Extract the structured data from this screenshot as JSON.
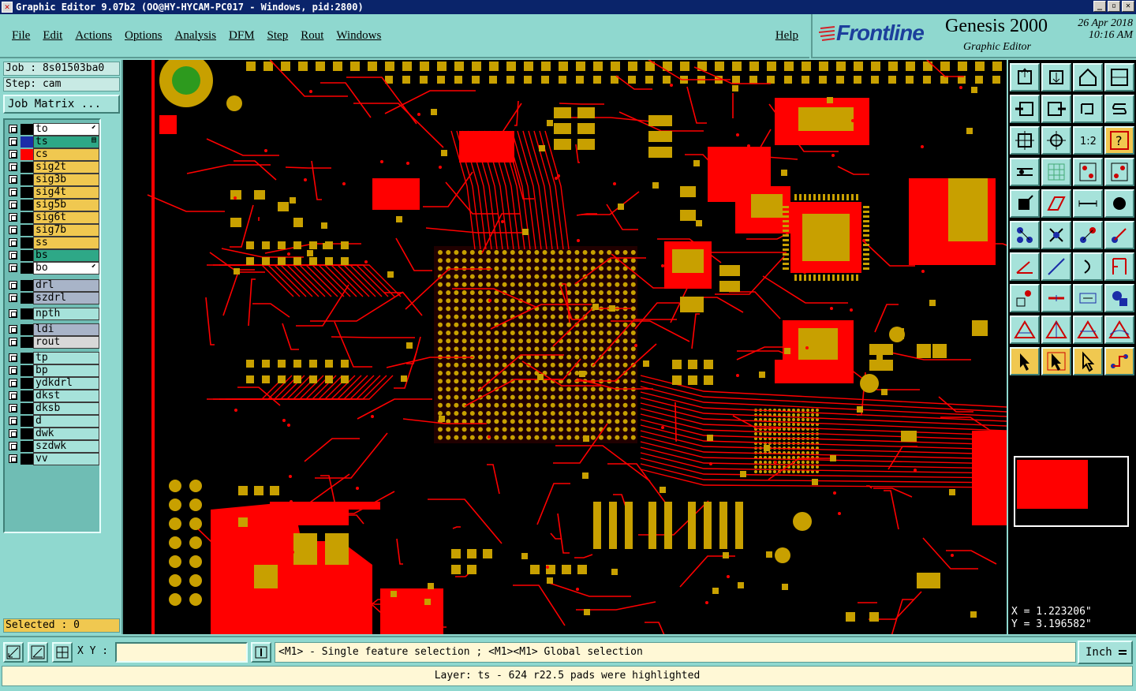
{
  "window": {
    "title": "Graphic Editor 9.07b2 (OO@HY-HYCAM-PC017 - Windows, pid:2800)",
    "controls": [
      "_",
      "▫",
      "✕"
    ]
  },
  "menu": {
    "items": [
      "File",
      "Edit",
      "Actions",
      "Options",
      "Analysis",
      "DFM",
      "Step",
      "Rout",
      "Windows"
    ],
    "help": "Help"
  },
  "brand": {
    "logo": "Frontline",
    "product": "Genesis 2000",
    "subtitle": "Graphic Editor",
    "date": "26 Apr 2018",
    "time": "10:16 AM"
  },
  "job": {
    "job_label": "Job : 8s01503ba0",
    "step_label": "Step: cam",
    "matrix_button": "Job Matrix ..."
  },
  "layers": [
    {
      "name": "to",
      "color": "#ffffff",
      "swatch": "#000000",
      "flag": "⬋"
    },
    {
      "name": "ts",
      "color": "#2ea887",
      "swatch": "#1a2ca8",
      "flag": "▤"
    },
    {
      "name": "cs",
      "color": "#f0c850",
      "swatch": "#ff0000",
      "flag": ""
    },
    {
      "name": "sig2t",
      "color": "#f0c850",
      "swatch": "#000000",
      "flag": ""
    },
    {
      "name": "sig3b",
      "color": "#f0c850",
      "swatch": "#000000",
      "flag": ""
    },
    {
      "name": "sig4t",
      "color": "#f0c850",
      "swatch": "#000000",
      "flag": ""
    },
    {
      "name": "sig5b",
      "color": "#f0c850",
      "swatch": "#000000",
      "flag": ""
    },
    {
      "name": "sig6t",
      "color": "#f0c850",
      "swatch": "#000000",
      "flag": ""
    },
    {
      "name": "sig7b",
      "color": "#f0c850",
      "swatch": "#000000",
      "flag": ""
    },
    {
      "name": "ss",
      "color": "#f0c850",
      "swatch": "#000000",
      "flag": ""
    },
    {
      "name": "bs",
      "color": "#2ea887",
      "swatch": "#000000",
      "flag": ""
    },
    {
      "name": "bo",
      "color": "#ffffff",
      "swatch": "#000000",
      "flag": "⬋"
    },
    {
      "name": "drl",
      "color": "#a8b4c8",
      "swatch": "#000000",
      "flag": ""
    },
    {
      "name": "szdrl",
      "color": "#a8b4c8",
      "swatch": "#000000",
      "flag": ""
    },
    {
      "name": "npth",
      "color": "#a6e2da",
      "swatch": "#000000",
      "flag": ""
    },
    {
      "name": "ldi",
      "color": "#a8b4c8",
      "swatch": "#000000",
      "flag": ""
    },
    {
      "name": "rout",
      "color": "#d8d8d8",
      "swatch": "#000000",
      "flag": ""
    },
    {
      "name": "tp",
      "color": "#a6e2da",
      "swatch": "#000000",
      "flag": ""
    },
    {
      "name": "bp",
      "color": "#a6e2da",
      "swatch": "#000000",
      "flag": ""
    },
    {
      "name": "ydkdrl",
      "color": "#a6e2da",
      "swatch": "#000000",
      "flag": ""
    },
    {
      "name": "dkst",
      "color": "#a6e2da",
      "swatch": "#000000",
      "flag": ""
    },
    {
      "name": "dksb",
      "color": "#a6e2da",
      "swatch": "#000000",
      "flag": ""
    },
    {
      "name": "d",
      "color": "#a6e2da",
      "swatch": "#000000",
      "flag": ""
    },
    {
      "name": "dwk",
      "color": "#a6e2da",
      "swatch": "#000000",
      "flag": ""
    },
    {
      "name": "szdwk",
      "color": "#a6e2da",
      "swatch": "#000000",
      "flag": ""
    },
    {
      "name": "vv",
      "color": "#a6e2da",
      "swatch": "#000000",
      "flag": ""
    }
  ],
  "selected": "Selected : 0",
  "coords": {
    "x": "X = 1.223206\"",
    "y": "Y = 3.196582\""
  },
  "xy_label": "X Y :",
  "xy_value": "",
  "message": "<M1> - Single feature selection ; <M1><M1> Global selection",
  "units": "Inch",
  "status": "Layer: ts - 624 r22.5 pads were highlighted",
  "colors": {
    "board_red": "#ff0000",
    "pad_gold": "#c8a000",
    "background": "#000000",
    "panel": "#8fd8cf"
  },
  "tools": [
    "open-icon",
    "save-icon",
    "home-icon",
    "window-icon",
    "step-in-icon",
    "step-out-icon",
    "undo-icon",
    "redo-icon",
    "zoom-fit-icon",
    "zoom-home-icon",
    "scale-1to2-icon",
    "help-icon",
    "measure-icon",
    "grid-icon",
    "layers-toggle-icon",
    "layers-select-icon",
    "add-pad-icon",
    "add-line-icon",
    "ruler-icon",
    "pad-icon",
    "connect-icon",
    "cross-icon",
    "move-icon",
    "rotate-icon",
    "draw-angle-icon",
    "line-icon",
    "arc-icon",
    "flip-icon",
    "node-icon",
    "bridge-icon",
    "dimension-icon",
    "shape-icon",
    "triangle-a-icon",
    "triangle-b-icon",
    "triangle-c-icon",
    "triangle-d-icon",
    "pointer-icon",
    "pointer-box-icon",
    "pointer-alt-icon",
    "route-icon"
  ]
}
